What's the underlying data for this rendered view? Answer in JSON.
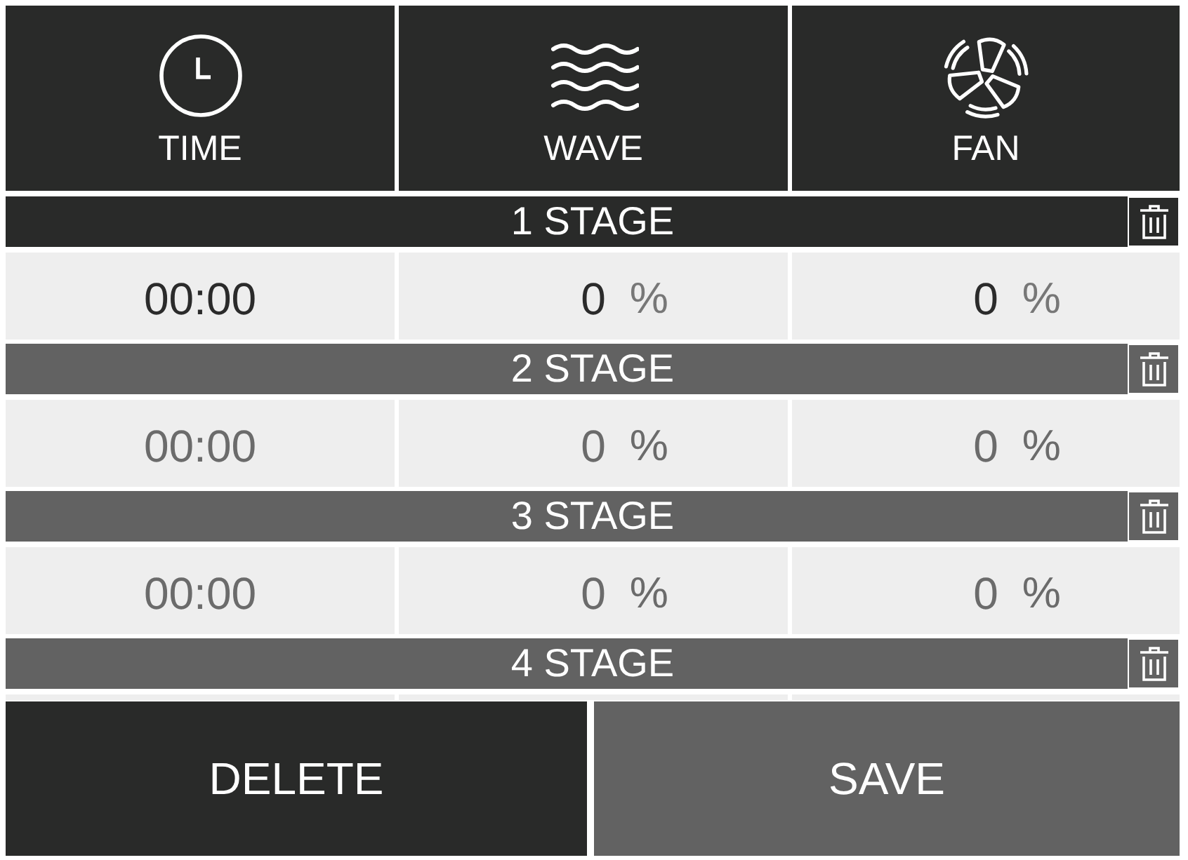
{
  "modes": [
    {
      "kind": "time",
      "label": "TIME"
    },
    {
      "kind": "wave",
      "label": "WAVE"
    },
    {
      "kind": "fan",
      "label": "FAN"
    }
  ],
  "stages": [
    {
      "title": "1 STAGE",
      "selected": true,
      "cells": [
        {
          "value": "00:00"
        },
        {
          "value": "0",
          "unit": "%"
        },
        {
          "value": "0",
          "unit": "%"
        }
      ]
    },
    {
      "title": "2 STAGE",
      "selected": false,
      "cells": [
        {
          "value": "00:00"
        },
        {
          "value": "0",
          "unit": "%"
        },
        {
          "value": "0",
          "unit": "%"
        }
      ]
    },
    {
      "title": "3 STAGE",
      "selected": false,
      "cells": [
        {
          "value": "00:00"
        },
        {
          "value": "0",
          "unit": "%"
        },
        {
          "value": "0",
          "unit": "%"
        }
      ]
    },
    {
      "title": "4 STAGE",
      "selected": false
    }
  ],
  "buttons": [
    {
      "kind": "delete",
      "label": "DELETE"
    },
    {
      "kind": "save",
      "label": "SAVE"
    }
  ]
}
